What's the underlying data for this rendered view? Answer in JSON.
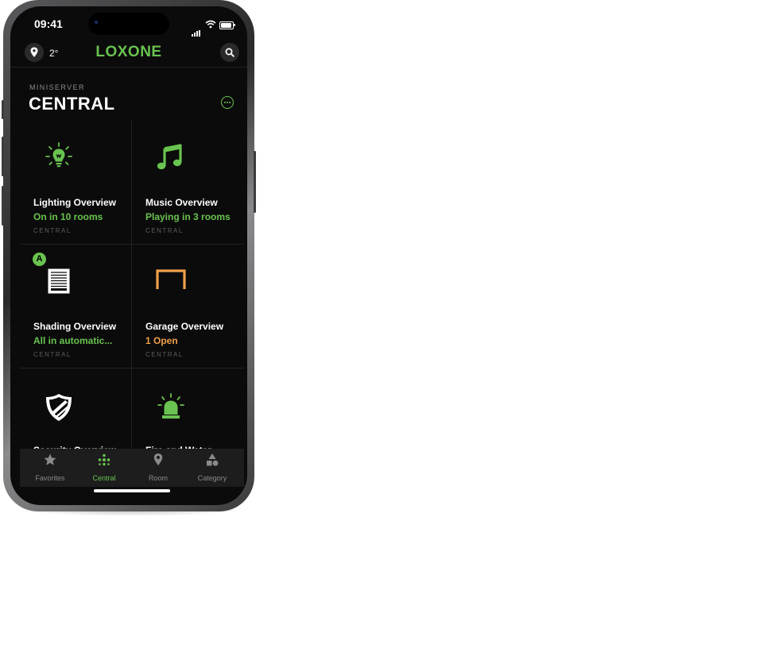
{
  "status_bar": {
    "time": "09:41"
  },
  "header": {
    "temperature": "2°",
    "logo": "LOXONE",
    "location_icon": "location-pin-icon",
    "search_icon": "search-icon"
  },
  "section": {
    "kicker": "MINISERVER",
    "title": "CENTRAL"
  },
  "tiles": [
    {
      "title": "Lighting Overview",
      "status": "On in 10 rooms",
      "room": "CENTRAL",
      "icon": "lightbulb-icon",
      "status_color": "#69c350"
    },
    {
      "title": "Music Overview",
      "status": "Playing in 3 rooms",
      "room": "CENTRAL",
      "icon": "music-note-icon",
      "status_color": "#69c350"
    },
    {
      "title": "Shading Overview",
      "status": "All in automatic...",
      "room": "CENTRAL",
      "icon": "blinds-icon",
      "badge": "A",
      "status_color": "#69c350"
    },
    {
      "title": "Garage Overview",
      "status": "1 Open",
      "room": "CENTRAL",
      "icon": "garage-door-icon",
      "status_color": "#f0a04b"
    },
    {
      "title": "Security Overview",
      "icon": "shield-icon"
    },
    {
      "title": "Fire and Water",
      "icon": "alarm-light-icon"
    }
  ],
  "tabs": [
    {
      "label": "Favorites",
      "icon": "star-icon",
      "active": false
    },
    {
      "label": "Central",
      "icon": "central-dots-icon",
      "active": true
    },
    {
      "label": "Room",
      "icon": "location-pin-icon",
      "active": false
    },
    {
      "label": "Category",
      "icon": "shapes-icon",
      "active": false
    }
  ],
  "colors": {
    "accent": "#69c350",
    "warning": "#f0a04b",
    "background": "#0b0b0b"
  }
}
